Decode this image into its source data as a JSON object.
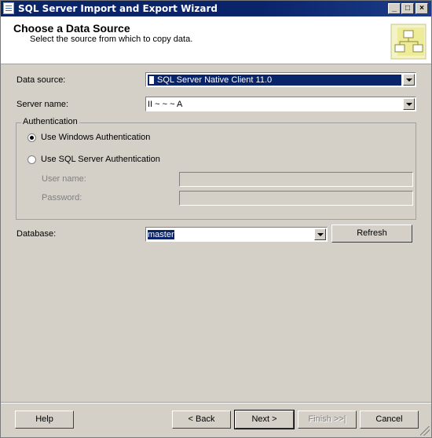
{
  "window": {
    "title": "SQL Server Import and Export Wizard",
    "controls": {
      "minimize": "_",
      "maximize": "□",
      "close": "×"
    }
  },
  "header": {
    "title": "Choose a Data Source",
    "subtitle": "Select the source from which to copy data."
  },
  "form": {
    "data_source_label": "Data source:",
    "data_source_value": "SQL Server Native Client 11.0",
    "server_name_label": "Server name:",
    "server_name_value": "II  ~ ~ ~  A",
    "auth_group_label": "Authentication",
    "auth_windows_label": "Use Windows Authentication",
    "auth_sql_label": "Use SQL Server Authentication",
    "username_label": "User name:",
    "password_label": "Password:",
    "database_label": "Database:",
    "database_value": "master",
    "refresh_label": "Refresh"
  },
  "footer": {
    "help": "Help",
    "back": "< Back",
    "next": "Next >",
    "finish": "Finish >>|",
    "cancel": "Cancel"
  },
  "colors": {
    "selection": "#0a246a",
    "dialog_bg": "#d4d0c8",
    "title_bar": "#0a246a"
  }
}
